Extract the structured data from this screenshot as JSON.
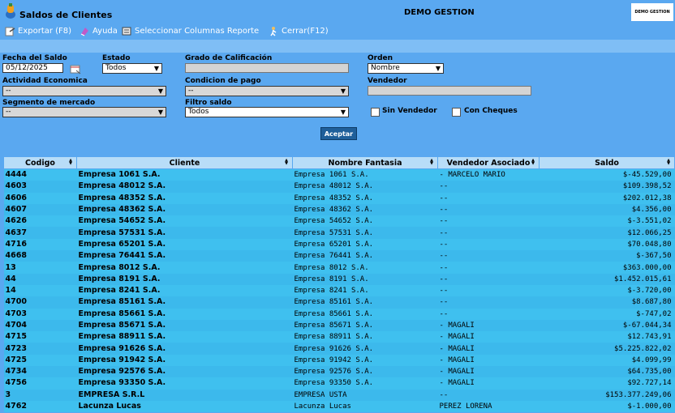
{
  "app": {
    "title": "Saldos de Clientes",
    "company": "DEMO GESTION",
    "brand": "DEMO GESTION"
  },
  "toolbar": {
    "export": "Exportar (F8)",
    "help": "Ayuda",
    "columns": "Seleccionar Columnas Reporte",
    "close": "Cerrar(F12)"
  },
  "filters": {
    "fecha_label": "Fecha del Saldo",
    "fecha_value": "05/12/2025",
    "estado_label": "Estado",
    "estado_value": "Todos",
    "calificacion_label": "Grado de Calificación",
    "orden_label": "Orden",
    "orden_value": "Nombre",
    "actividad_label": "Actividad Economica",
    "actividad_value": "--",
    "condicion_label": "Condicion de pago",
    "condicion_value": "--",
    "vendedor_label": "Vendedor",
    "segmento_label": "Segmento de mercado",
    "segmento_value": "--",
    "filtro_label": "Filtro saldo",
    "filtro_value": "Todos",
    "sin_vendedor": "Sin Vendedor",
    "con_cheques": "Con Cheques",
    "accept": "Aceptar"
  },
  "table": {
    "headers": [
      "Codigo",
      "Cliente",
      "Nombre Fantasia",
      "Vendedor Asociado",
      "Saldo"
    ],
    "rows": [
      [
        "4444",
        "Empresa 1061 S.A.",
        "Empresa 1061 S.A.",
        "- MARCELO MARIO",
        "$-45.529,00"
      ],
      [
        "4603",
        "Empresa 48012 S.A.",
        "Empresa 48012 S.A.",
        "--",
        "$109.398,52"
      ],
      [
        "4606",
        "Empresa 48352 S.A.",
        "Empresa 48352 S.A.",
        "--",
        "$202.012,38"
      ],
      [
        "4607",
        "Empresa 48362 S.A.",
        "Empresa 48362 S.A.",
        "--",
        "$4.356,00"
      ],
      [
        "4626",
        "Empresa 54652 S.A.",
        "Empresa 54652 S.A.",
        "--",
        "$-3.551,02"
      ],
      [
        "4637",
        "Empresa 57531 S.A.",
        "Empresa 57531 S.A.",
        "--",
        "$12.066,25"
      ],
      [
        "4716",
        "Empresa 65201 S.A.",
        "Empresa 65201 S.A.",
        "--",
        "$70.048,80"
      ],
      [
        "4668",
        "Empresa 76441 S.A.",
        "Empresa 76441 S.A.",
        "--",
        "$-367,50"
      ],
      [
        "13",
        "Empresa 8012 S.A.",
        "Empresa 8012 S.A.",
        "--",
        "$363.000,00"
      ],
      [
        "44",
        "Empresa 8191 S.A.",
        "Empresa 8191 S.A.",
        "--",
        "$1.452.015,61"
      ],
      [
        "14",
        "Empresa 8241 S.A.",
        "Empresa 8241 S.A.",
        "--",
        "$-3.720,00"
      ],
      [
        "4700",
        "Empresa 85161 S.A.",
        "Empresa 85161 S.A.",
        "--",
        "$8.687,80"
      ],
      [
        "4703",
        "Empresa 85661 S.A.",
        "Empresa 85661 S.A.",
        "--",
        "$-747,02"
      ],
      [
        "4704",
        "Empresa 85671 S.A.",
        "Empresa 85671 S.A.",
        "- MAGALI",
        "$-67.044,34"
      ],
      [
        "4715",
        "Empresa 88911 S.A.",
        "Empresa 88911 S.A.",
        "- MAGALI",
        "$12.743,91"
      ],
      [
        "4723",
        "Empresa 91626 S.A.",
        "Empresa 91626 S.A.",
        "- MAGALI",
        "$5.225.822,02"
      ],
      [
        "4725",
        "Empresa 91942 S.A.",
        "Empresa 91942 S.A.",
        "- MAGALI",
        "$4.099,99"
      ],
      [
        "4734",
        "Empresa 92576 S.A.",
        "Empresa 92576 S.A.",
        "- MAGALI",
        "$64.735,00"
      ],
      [
        "4756",
        "Empresa 93350 S.A.",
        "Empresa 93350 S.A.",
        "- MAGALI",
        "$92.727,14"
      ],
      [
        "3",
        "EMPRESA S.R.L",
        "EMPRESA USTA",
        "--",
        "$153.377.249,06"
      ],
      [
        "4762",
        "Lacunza Lucas",
        "Lacunza Lucas",
        "PEREZ LORENA",
        "$-1.000,00"
      ]
    ]
  }
}
